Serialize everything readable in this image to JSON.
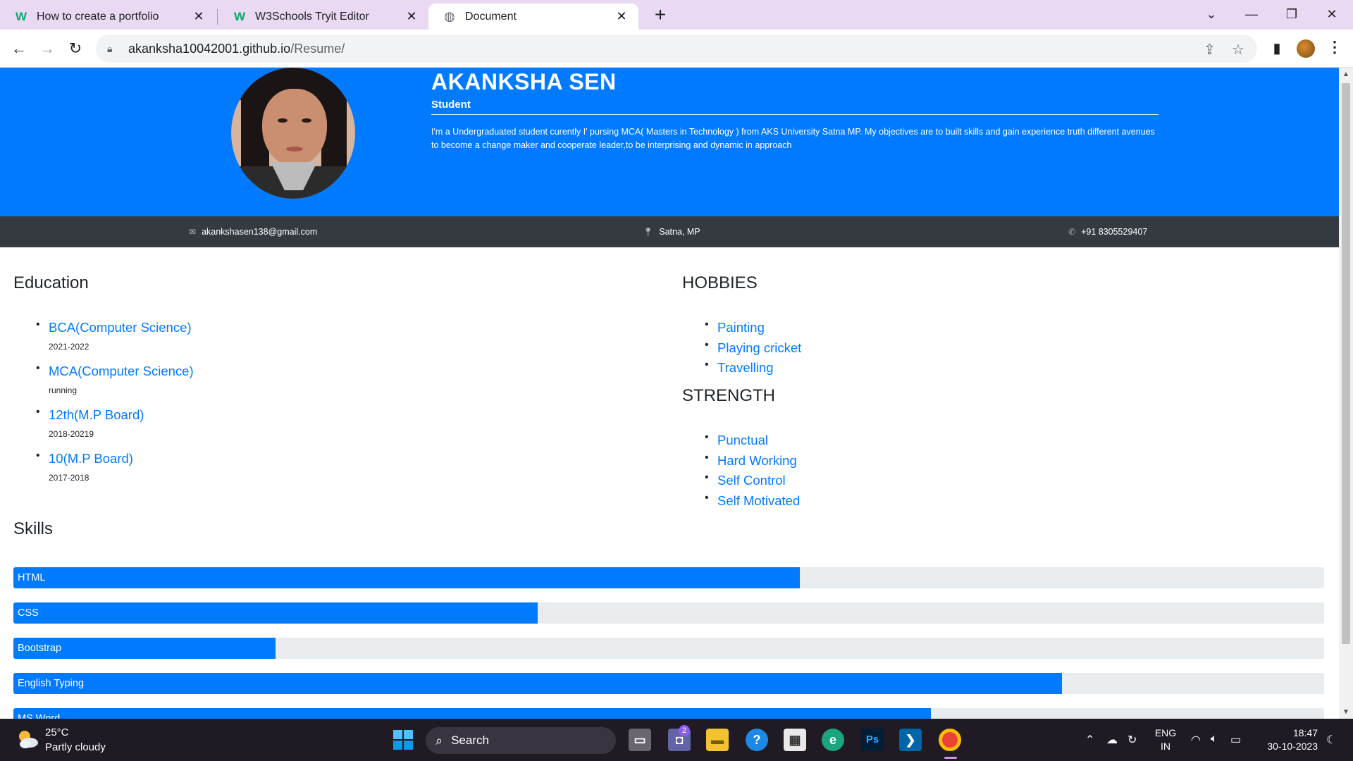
{
  "browser": {
    "tabs": [
      {
        "title": "How to create a portfolio",
        "favicon": "w3schools-icon"
      },
      {
        "title": "W3Schools Tryit Editor",
        "favicon": "w3schools-icon"
      },
      {
        "title": "Document",
        "favicon": "globe-icon",
        "active": true
      }
    ],
    "url_host": "akanksha10042001.github.io",
    "url_path": "/Resume/"
  },
  "profile": {
    "name": "AKANKSHA SEN",
    "role": "Student",
    "about": "I'm a Undergraduated student curently I' pursing MCA( Masters in Technology ) from AKS University Satna MP. My objectives are to built skills and gain experience truth different avenues to become a change maker and cooperate leader,to be interprising and dynamic in approach"
  },
  "contact": {
    "email": "akankshasen138@gmail.com",
    "location": "Satna, MP",
    "phone": "+91 8305529407"
  },
  "education": {
    "title": "Education",
    "items": [
      {
        "degree": "BCA(Computer Science)",
        "years": "2021-2022"
      },
      {
        "degree": "MCA(Computer Science)",
        "years": "running"
      },
      {
        "degree": "12th(M.P Board)",
        "years": "2018-20219"
      },
      {
        "degree": "10(M.P Board)",
        "years": "2017-2018"
      }
    ]
  },
  "hobbies": {
    "title": "HOBBIES",
    "items": [
      "Painting",
      "Playing cricket",
      "Travelling"
    ]
  },
  "strength": {
    "title": "STRENGTH",
    "items": [
      "Punctual",
      "Hard Working",
      "Self Control",
      "Self Motivated"
    ]
  },
  "skills": {
    "title": "Skills",
    "items": [
      {
        "name": "HTML",
        "percent": 60
      },
      {
        "name": "CSS",
        "percent": 40
      },
      {
        "name": "Bootstrap",
        "percent": 20
      },
      {
        "name": "English Typing",
        "percent": 80
      },
      {
        "name": "MS Word",
        "percent": 70
      }
    ]
  },
  "taskbar": {
    "temperature": "25°C",
    "condition": "Partly cloudy",
    "search_label": "Search",
    "language": "ENG",
    "region": "IN",
    "time": "18:47",
    "date": "30-10-2023",
    "teams_badge": "2"
  },
  "colors": {
    "primary": "#007bff",
    "dark": "#343a40",
    "tabstrip": "#ead9f3",
    "taskbar": "#1f1a24"
  }
}
